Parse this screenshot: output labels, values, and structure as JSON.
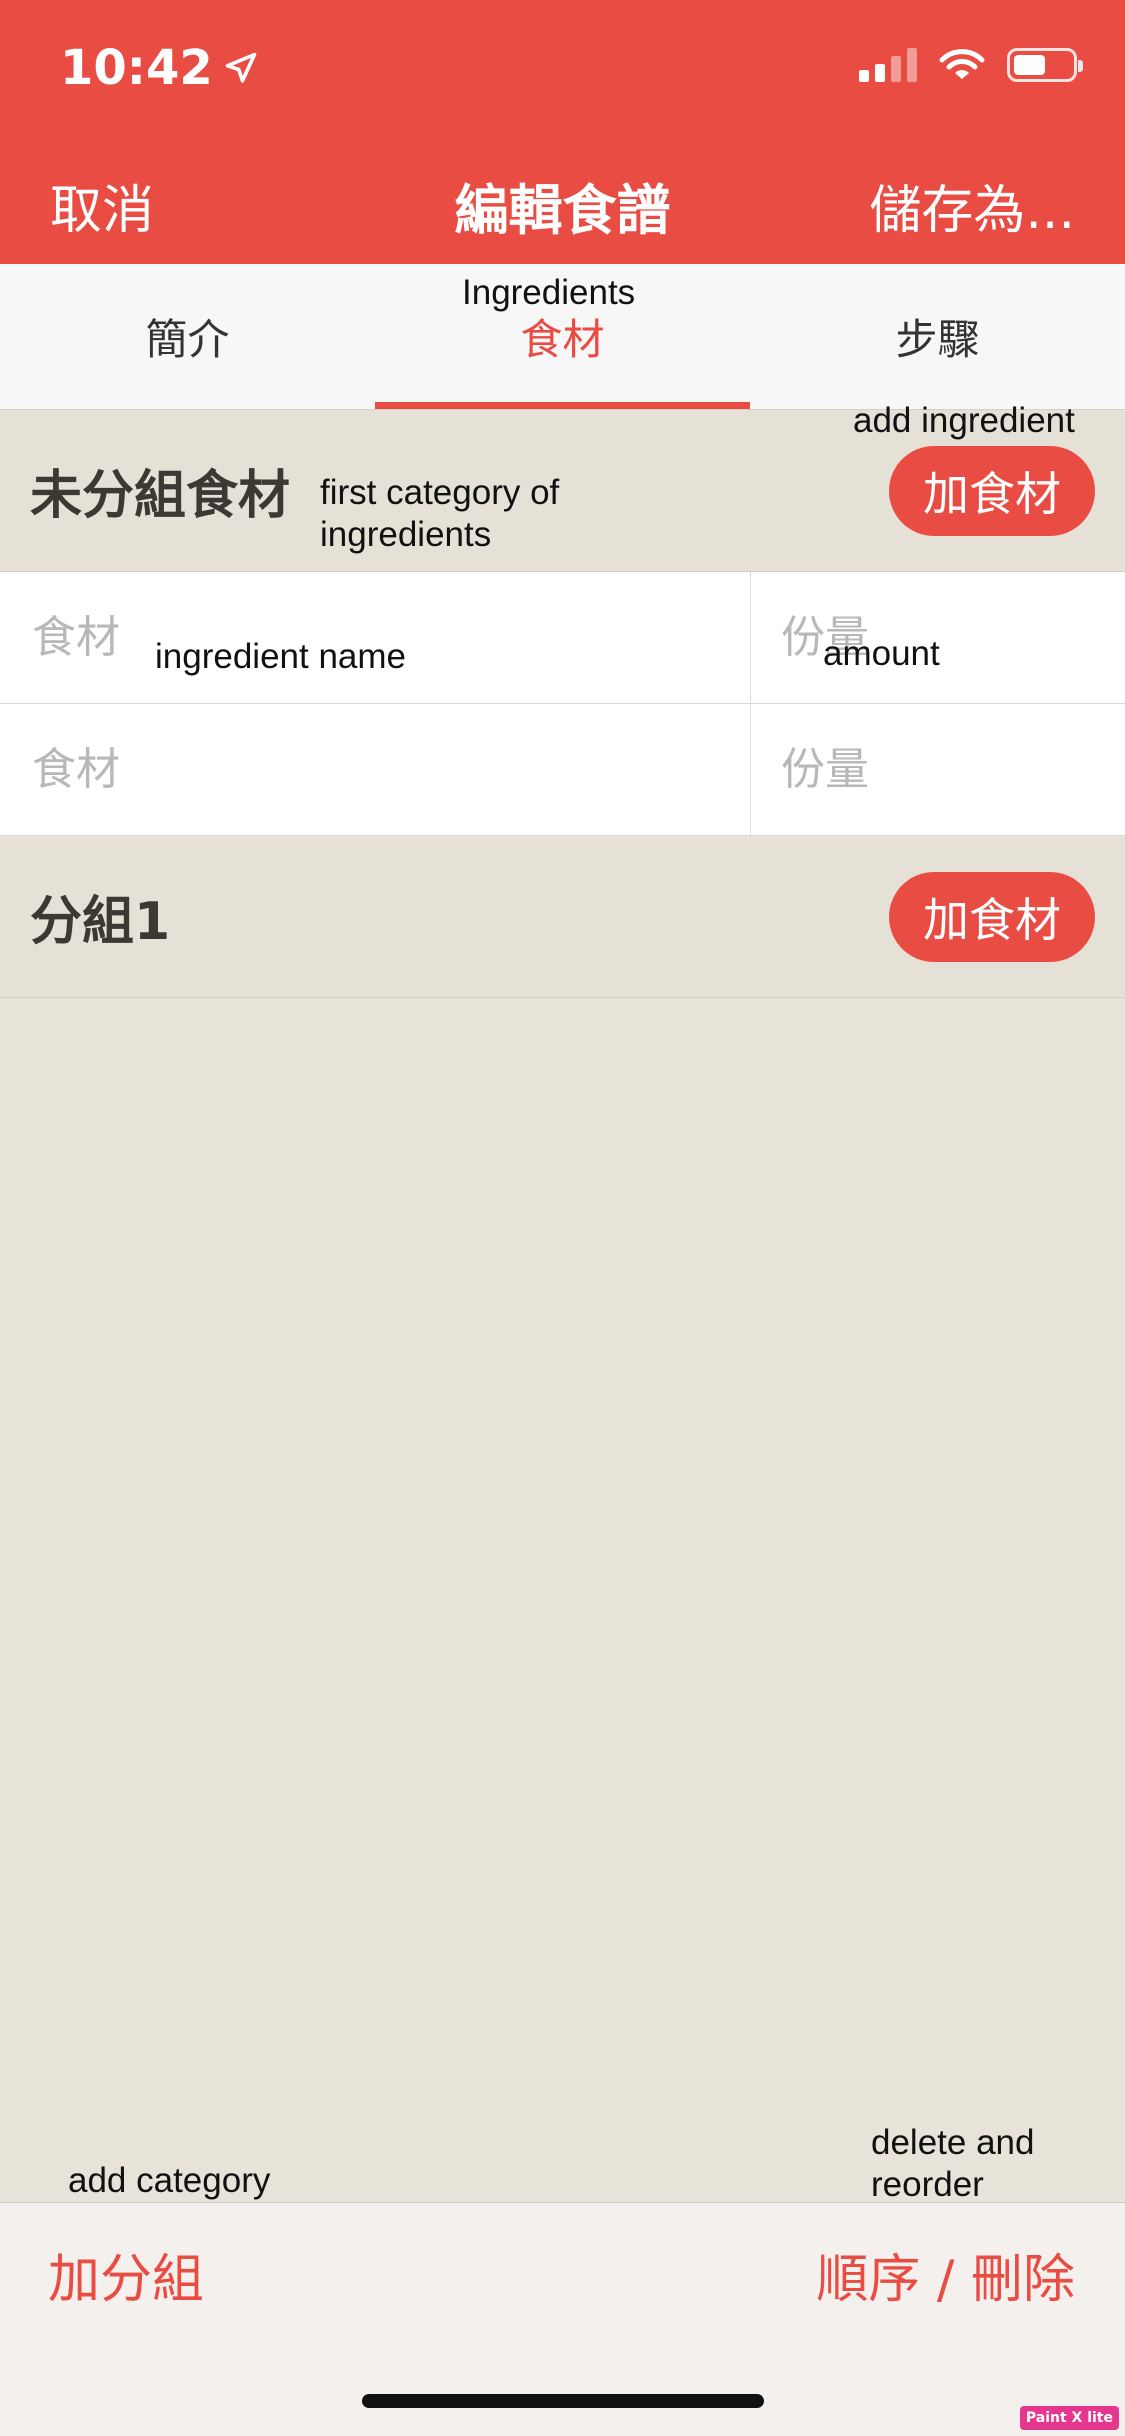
{
  "status_bar": {
    "time": "10:42",
    "icons": [
      "location-arrow-icon",
      "cellular-signal-icon",
      "wifi-icon",
      "battery-icon"
    ]
  },
  "nav": {
    "cancel_label": "取消",
    "title": "編輯食譜",
    "save_label": "儲存為..."
  },
  "tabs": [
    {
      "label": "簡介",
      "active": false
    },
    {
      "label": "食材",
      "active": true
    },
    {
      "label": "步驟",
      "active": false
    }
  ],
  "categories": [
    {
      "title": "未分組食材",
      "add_button_label": "加食材",
      "ingredients": [
        {
          "name_placeholder": "食材",
          "amount_placeholder": "份量"
        },
        {
          "name_placeholder": "食材",
          "amount_placeholder": "份量"
        }
      ]
    },
    {
      "title": "分組1",
      "add_button_label": "加食材",
      "ingredients": []
    }
  ],
  "annotations": {
    "tab": "Ingredients",
    "add_ingredient": "add ingredient",
    "first_category": "first category of ingredients",
    "ingredient_name": "ingredient name",
    "amount": "amount",
    "add_category": "add category",
    "delete_reorder": "delete and reorder"
  },
  "bottom_bar": {
    "add_category_label": "加分組",
    "reorder_delete_label": "順序 / 刪除"
  },
  "watermark": "Paint X lite",
  "colors": {
    "accent": "#e84c43",
    "background": "#e8e3d9",
    "category_header": "#e6e1d7",
    "tabs_background": "#f7f7f7",
    "bottom_bar": "#f3f0ed"
  }
}
